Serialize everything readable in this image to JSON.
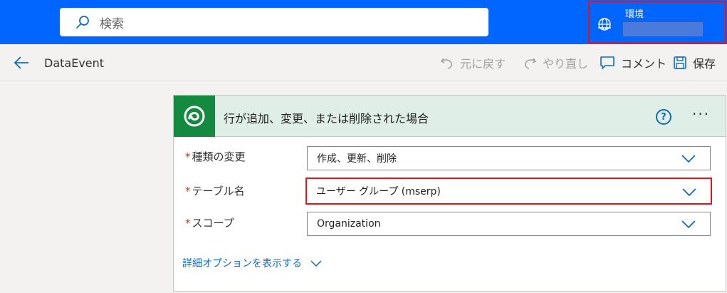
{
  "search": {
    "placeholder": "検索"
  },
  "environment": {
    "label": "環境"
  },
  "command_bar": {
    "flow_name": "DataEvent",
    "undo_label": "元に戻す",
    "redo_label": "やり直し",
    "comment_label": "コメント",
    "save_label": "保存"
  },
  "trigger_card": {
    "title": "行が追加、変更、または削除された場合",
    "help_symbol": "?",
    "more_symbol": "···",
    "fields": [
      {
        "required_mark": "*",
        "label": "種類の変更",
        "value": "作成、更新、削除"
      },
      {
        "required_mark": "*",
        "label": "テーブル名",
        "value": "ユーザー グループ (mserp)"
      },
      {
        "required_mark": "*",
        "label": "スコープ",
        "value": "Organization"
      }
    ],
    "advanced_options_label": "詳細オプションを表示する"
  },
  "colors": {
    "top_bar": "#0066ff",
    "highlight_border": "#e3121b",
    "card_header": "#dfeee7",
    "logo_bg": "#138a3f",
    "link": "#0f6cbd"
  }
}
